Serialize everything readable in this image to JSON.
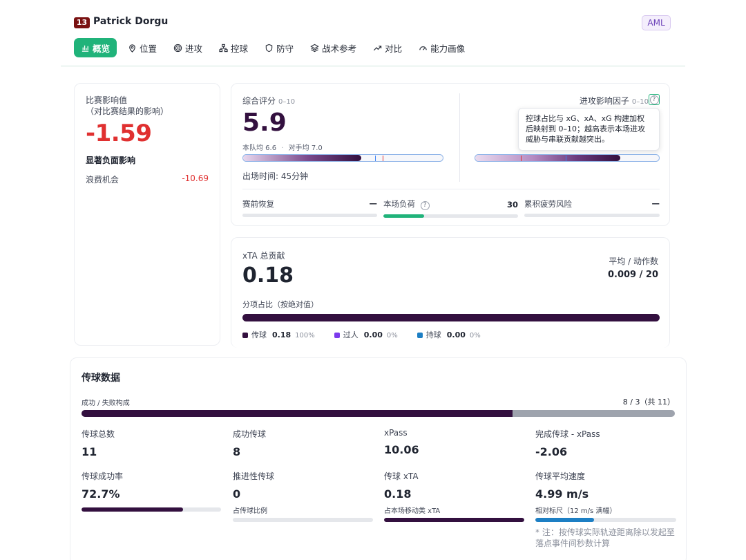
{
  "player": {
    "number": "13",
    "name": "Patrick Dorgu",
    "position": "AML"
  },
  "tabs": [
    {
      "label": "概览",
      "icon": "bar-chart-icon",
      "active": true
    },
    {
      "label": "位置",
      "icon": "location-pin-icon"
    },
    {
      "label": "进攻",
      "icon": "target-icon"
    },
    {
      "label": "控球",
      "icon": "network-icon"
    },
    {
      "label": "防守",
      "icon": "shield-icon"
    },
    {
      "label": "战术参考",
      "icon": "layers-icon"
    },
    {
      "label": "对比",
      "icon": "trend-icon"
    },
    {
      "label": "能力画像",
      "icon": "gauge-icon"
    }
  ],
  "impact": {
    "title": "比赛影响值",
    "subtitle": "（对比赛结果的影响）",
    "value": "-1.59",
    "description": "显著负面影响",
    "item_label": "浪费机会",
    "item_value": "-10.69"
  },
  "rating": {
    "title": "综合评分",
    "range": "0–10",
    "value": "5.9",
    "team_avg": "本队均 6.6",
    "sep": "·",
    "opp_avg": "对手均 7.0",
    "bar_fraction": 0.59,
    "team_avg_fraction": 0.66,
    "opp_avg_fraction": 0.7,
    "attack_title": "进攻影响因子",
    "attack_range": "0–10",
    "help": "?",
    "tooltip": "控球占比与 xG、xA、xG 构建加权后映射到 0–10；越高表示本场进攻威胁与串联贡献越突出。",
    "minutes": "出场时间: 45分钟",
    "metrics": [
      {
        "label": "赛前恢复",
        "value": "—",
        "fraction": 0
      },
      {
        "label": "本场负荷",
        "value": "30",
        "fraction": 0.3
      },
      {
        "label": "累积疲劳风险",
        "value": "—",
        "fraction": 0
      }
    ]
  },
  "xta": {
    "title": "xTA 总贡献",
    "value": "0.18",
    "avg_label": "平均 / 动作数",
    "avg_value": "0.009 / 20",
    "share_label": "分项占比（按绝对值）",
    "legend": [
      {
        "label": "传球",
        "value": "0.18",
        "pct": "100%",
        "color": "#33103f"
      },
      {
        "label": "过人",
        "value": "0.00",
        "pct": "0%",
        "color": "#7c3aed"
      },
      {
        "label": "持球",
        "value": "0.00",
        "pct": "0%",
        "color": "#1d7fc4"
      }
    ]
  },
  "pass": {
    "title": "传球数据",
    "sub": "成功 / 失败构成",
    "ratio": "8 / 3（共 11）",
    "success_fraction": 0.727,
    "stats": [
      {
        "label": "传球总数",
        "value": "11"
      },
      {
        "label": "成功传球",
        "value": "8"
      },
      {
        "label": "xPass",
        "value": "10.06"
      },
      {
        "label": "完成传球 - xPass",
        "value": "-2.06"
      },
      {
        "label": "传球成功率",
        "value": "72.7%"
      },
      {
        "label": "推进性传球",
        "value": "0"
      },
      {
        "label": "传球 xTA",
        "value": "0.18"
      },
      {
        "label": "传球平均速度",
        "value": "4.99 m/s"
      }
    ],
    "captions": {
      "progressive": "占传球比例",
      "xta": "占本场移动类 xTA",
      "speed": "相对标尺（12 m/s 满幅）"
    },
    "success_rate_fraction": 0.727,
    "progressive_fraction": 0,
    "xta_fraction": 1.0,
    "speed_fraction": 0.416,
    "note": "* 注：按传球实际轨迹距离除以发起至落点事件间秒数计算"
  },
  "colors": {
    "accent": "#20b37a",
    "negative": "#e03030",
    "dark": "#33103f",
    "blue": "#1d7fc4"
  }
}
